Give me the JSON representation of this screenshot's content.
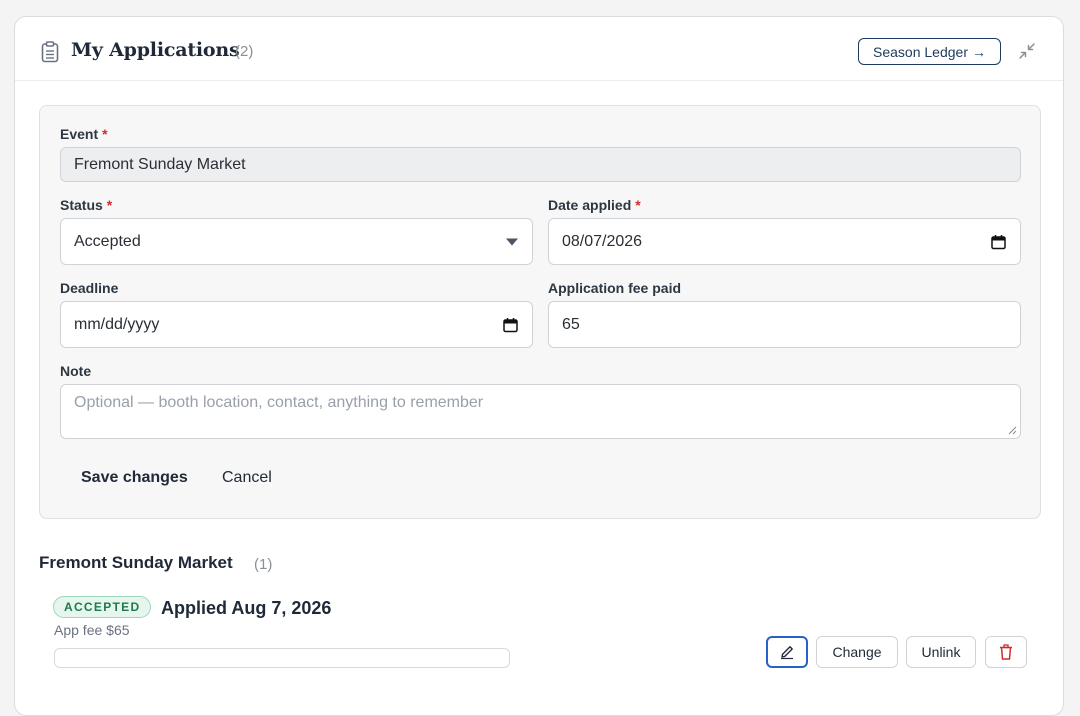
{
  "header": {
    "title": "My Applications",
    "count": "(2)",
    "ledger_label": "Season Ledger",
    "ledger_arrow": "→"
  },
  "form": {
    "event_label": "Event",
    "event_value": "Fremont Sunday Market",
    "status_label": "Status",
    "status_value": "Accepted",
    "date_applied_label": "Date applied",
    "date_applied_value": "08/07/2026",
    "deadline_label": "Deadline",
    "deadline_value": "mm/dd/yyyy",
    "fee_label": "Application fee paid",
    "fee_value": "65",
    "note_label": "Note",
    "note_placeholder": "Optional — booth location, contact, anything to remember",
    "required_mark": "*",
    "save_label": "Save changes",
    "cancel_label": "Cancel"
  },
  "group": {
    "title": "Fremont Sunday Market",
    "count": "(1)",
    "entry": {
      "status_badge": "ACCEPTED",
      "applied": "Applied Aug 7, 2026",
      "fee": "App fee $65",
      "change_label": "Change",
      "unlink_label": "Unlink"
    }
  },
  "colors": {
    "accent": "#1e3a5f",
    "required": "#d02c2c",
    "accepted_bg": "#e6f6ee",
    "accepted_text": "#1d7a4a",
    "edit_border": "#2563c9",
    "delete_red": "#d02c2c"
  }
}
